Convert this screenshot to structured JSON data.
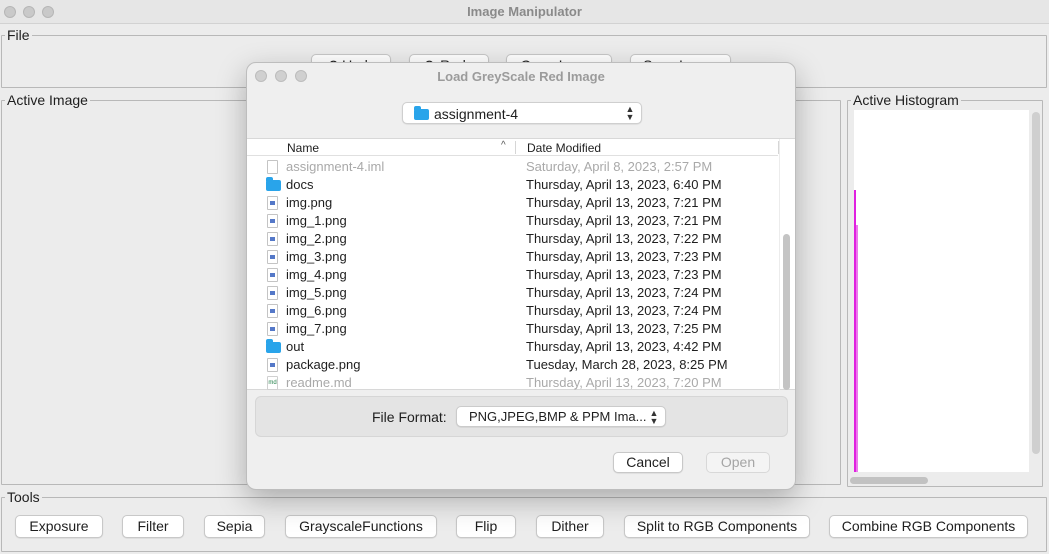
{
  "window": {
    "title": "Image Manipulator"
  },
  "file_panel": {
    "legend": "File",
    "buttons": [
      "Undo",
      "Redo",
      "Open Image",
      "Save Image"
    ]
  },
  "active_image": {
    "legend": "Active Image"
  },
  "active_histogram": {
    "legend": "Active Histogram",
    "line_color": "#e020e0"
  },
  "tools": {
    "legend": "Tools",
    "buttons": [
      "Exposure",
      "Filter",
      "Sepia",
      "GrayscaleFunctions",
      "Flip",
      "Dither",
      "Split to RGB Components",
      "Combine RGB Components"
    ]
  },
  "dialog": {
    "title": "Load GreyScale Red Image",
    "directory": "assignment-4",
    "columns": {
      "name": "Name",
      "date": "Date Modified"
    },
    "files": [
      {
        "name": "assignment-4.iml",
        "date": "Saturday, April 8, 2023, 2:57 PM",
        "type": "file",
        "dimmed": true
      },
      {
        "name": "docs",
        "date": "Thursday, April 13, 2023, 6:40 PM",
        "type": "folder",
        "dimmed": false
      },
      {
        "name": "img.png",
        "date": "Thursday, April 13, 2023, 7:21 PM",
        "type": "png",
        "dimmed": false
      },
      {
        "name": "img_1.png",
        "date": "Thursday, April 13, 2023, 7:21 PM",
        "type": "png",
        "dimmed": false
      },
      {
        "name": "img_2.png",
        "date": "Thursday, April 13, 2023, 7:22 PM",
        "type": "png",
        "dimmed": false
      },
      {
        "name": "img_3.png",
        "date": "Thursday, April 13, 2023, 7:23 PM",
        "type": "png",
        "dimmed": false
      },
      {
        "name": "img_4.png",
        "date": "Thursday, April 13, 2023, 7:23 PM",
        "type": "png",
        "dimmed": false
      },
      {
        "name": "img_5.png",
        "date": "Thursday, April 13, 2023, 7:24 PM",
        "type": "png",
        "dimmed": false
      },
      {
        "name": "img_6.png",
        "date": "Thursday, April 13, 2023, 7:24 PM",
        "type": "png",
        "dimmed": false
      },
      {
        "name": "img_7.png",
        "date": "Thursday, April 13, 2023, 7:25 PM",
        "type": "png",
        "dimmed": false
      },
      {
        "name": "out",
        "date": "Thursday, April 13, 2023, 4:42 PM",
        "type": "folder",
        "dimmed": false
      },
      {
        "name": "package.png",
        "date": "Tuesday, March 28, 2023, 8:25 PM",
        "type": "png",
        "dimmed": false
      },
      {
        "name": "readme.md",
        "date": "Thursday, April 13, 2023, 7:20 PM",
        "type": "md",
        "dimmed": true
      }
    ],
    "file_format_label": "File Format:",
    "file_format_value": "PNG,JPEG,BMP & PPM Ima...",
    "cancel_label": "Cancel",
    "open_label": "Open"
  }
}
